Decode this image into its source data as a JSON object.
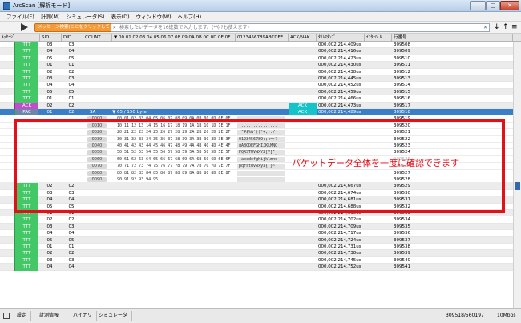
{
  "window": {
    "title": "ArcScan [解析モード]",
    "min_label": "—",
    "max_label": "□",
    "close_label": "✕"
  },
  "menu": [
    "ファイル(F)",
    "計測(M)",
    "シミュレータ(S)",
    "表示(D)",
    "ウィンドウ(W)",
    "ヘルプ(H)"
  ],
  "toolbar": {
    "message_button_label": "メッセージ検索(ここをクリックしてください)",
    "search_placeholder": "検索したいデータを16進数で入力します。(*や?も使えます)",
    "down_arrow": "↓",
    "up_arrow": "↑",
    "menu_icon": "≡"
  },
  "columns": {
    "message": "ﾒｯｾｰｼﾞ",
    "sid": "SID",
    "did": "DID",
    "count": "COUNT",
    "hex_header": "▼ 00 01 02 03 04 05 06 07 08 09 0A 0B 0C 0D 0E 0F",
    "ascii_header": "0123456789ABCDEF",
    "ack_nak": "ACK/NAK",
    "timestamp": "ﾀｲﾑｽﾀﾝﾌﾟ",
    "interval": "ｲﾝﾀｰﾊﾞﾙ",
    "line_no": "行番号"
  },
  "rows_top": [
    {
      "msg": "TTT",
      "sid": "03",
      "did": "03",
      "ack": "",
      "ts": "000,002,214,409us",
      "line": "309508"
    },
    {
      "msg": "TTT",
      "sid": "04",
      "did": "04",
      "ack": "",
      "ts": "000,002,214,416us",
      "line": "309509"
    },
    {
      "msg": "TTT",
      "sid": "05",
      "did": "05",
      "ack": "",
      "ts": "000,002,214,423us",
      "line": "309510"
    },
    {
      "msg": "TTT",
      "sid": "01",
      "did": "01",
      "ack": "",
      "ts": "000,002,214,430us",
      "line": "309511"
    },
    {
      "msg": "TTT",
      "sid": "02",
      "did": "02",
      "ack": "",
      "ts": "000,002,214,438us",
      "line": "309512"
    },
    {
      "msg": "TTT",
      "sid": "03",
      "did": "03",
      "ack": "",
      "ts": "000,002,214,445us",
      "line": "309513"
    },
    {
      "msg": "TTT",
      "sid": "04",
      "did": "04",
      "ack": "",
      "ts": "000,002,214,452us",
      "line": "309514"
    },
    {
      "msg": "TTT",
      "sid": "05",
      "did": "05",
      "ack": "",
      "ts": "000,002,214,459us",
      "line": "309515"
    },
    {
      "msg": "TTT",
      "sid": "01",
      "did": "01",
      "ack": "",
      "ts": "000,002,214,466us",
      "line": "309516"
    },
    {
      "msg": "ACK",
      "sid": "02",
      "did": "02",
      "ack": "ACK",
      "ts": "000,002,214,473us",
      "line": "309517"
    }
  ],
  "selected_row": {
    "msg": "PAC",
    "sid": "01",
    "did": "02",
    "count": "SA",
    "summary": "▼ 65 / 150 byte",
    "ack": "ACK",
    "ts": "000,002,214,489us",
    "line": "309518"
  },
  "dump_rows": [
    {
      "offset": "0000",
      "hex": "00 01 02 03 04 05 06 07 08 09 0A 0B 0C 0D 0E 0F",
      "ascii": "................",
      "line": "309519"
    },
    {
      "offset": "0010",
      "hex": "10 11 12 13 14 15 16 17 18 19 1A 1B 1C 1D 1E 1F",
      "ascii": "................",
      "line": "309520"
    },
    {
      "offset": "0020",
      "hex": "20 21 22 23 24 25 26 27 28 29 2A 2B 2C 2D 2E 2F",
      "ascii": " !\"#$%&'()*+,-./",
      "line": "309521"
    },
    {
      "offset": "0030",
      "hex": "30 31 32 33 34 35 36 37 38 39 3A 3B 3C 3D 3E 3F",
      "ascii": "0123456789:;<=>?",
      "line": "309522"
    },
    {
      "offset": "0040",
      "hex": "40 41 42 43 44 45 46 47 48 49 4A 4B 4C 4D 4E 4F",
      "ascii": "@ABCDEFGHIJKLMNO",
      "line": "309523"
    },
    {
      "offset": "0050",
      "hex": "50 51 52 53 54 55 56 57 58 59 5A 5B 5C 5D 5E 5F",
      "ascii": "PQRSTUVWXYZ[¥]^_",
      "line": "309524"
    },
    {
      "offset": "0060",
      "hex": "60 61 62 63 64 65 66 67 68 69 6A 6B 6C 6D 6E 6F",
      "ascii": "`abcdefghijklmno",
      "line": "309525"
    },
    {
      "offset": "0070",
      "hex": "70 71 72 73 74 75 76 77 78 79 7A 7B 7C 7D 7E 7F",
      "ascii": "pqrstuvwxyz{|}~",
      "line": "309526"
    },
    {
      "offset": "0080",
      "hex": "80 81 82 83 84 85 86 87 88 89 8A 8B 8C 8D 8E 8F",
      "ascii": ".",
      "line": "309527"
    },
    {
      "offset": "0090",
      "hex": "90 91 92 93 94 95",
      "ascii": "",
      "line": "309528"
    }
  ],
  "rows_bottom": [
    {
      "msg": "TTT",
      "sid": "02",
      "did": "02",
      "ack": "",
      "ts": "000,002,214,667us",
      "line": "309529"
    },
    {
      "msg": "TTT",
      "sid": "03",
      "did": "03",
      "ack": "",
      "ts": "000,002,214,674us",
      "line": "309530"
    },
    {
      "msg": "TTT",
      "sid": "04",
      "did": "04",
      "ack": "",
      "ts": "000,002,214,681us",
      "line": "309531"
    },
    {
      "msg": "TTT",
      "sid": "05",
      "did": "05",
      "ack": "",
      "ts": "000,002,214,688us",
      "line": "309532"
    },
    {
      "msg": "TTT",
      "sid": "01",
      "did": "01",
      "ack": "",
      "ts": "000,002,214,695us",
      "line": "309533"
    },
    {
      "msg": "TTT",
      "sid": "02",
      "did": "02",
      "ack": "",
      "ts": "000,002,214,702us",
      "line": "309534"
    },
    {
      "msg": "TTT",
      "sid": "03",
      "did": "03",
      "ack": "",
      "ts": "000,002,214,709us",
      "line": "309535"
    },
    {
      "msg": "TTT",
      "sid": "04",
      "did": "04",
      "ack": "",
      "ts": "000,002,214,717us",
      "line": "309536"
    },
    {
      "msg": "TTT",
      "sid": "05",
      "did": "05",
      "ack": "",
      "ts": "000,002,214,724us",
      "line": "309537"
    },
    {
      "msg": "TTT",
      "sid": "01",
      "did": "01",
      "ack": "",
      "ts": "000,002,214,731us",
      "line": "309538"
    },
    {
      "msg": "TTT",
      "sid": "02",
      "did": "02",
      "ack": "",
      "ts": "000,002,214,738us",
      "line": "309539"
    },
    {
      "msg": "TTT",
      "sid": "03",
      "did": "03",
      "ack": "",
      "ts": "000,002,214,745us",
      "line": "309540"
    },
    {
      "msg": "TTT",
      "sid": "04",
      "did": "04",
      "ack": "",
      "ts": "000,002,214,752us",
      "line": "309541"
    }
  ],
  "overlay": {
    "text": "パケットデータ全体を一度に確認できます"
  },
  "tabs": [
    "設定",
    "計測情報",
    "バイナリ",
    "シミュレータ"
  ],
  "status": {
    "position": "309518/560197",
    "speed": "10Mbps"
  },
  "colors": {
    "ttt_green": "#44c767",
    "ack_magenta": "#c24cc9",
    "ack_cyan": "#16c3c9",
    "selection_blue": "#3a7ec8",
    "highlight_red": "#e3101a",
    "message_button_orange": "#f39a3a"
  }
}
